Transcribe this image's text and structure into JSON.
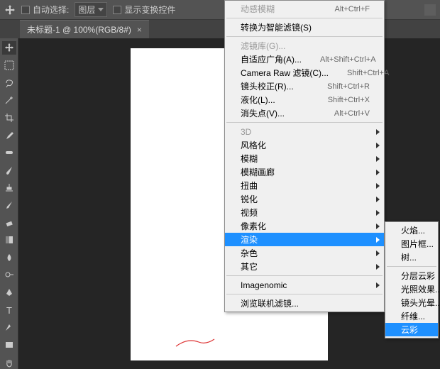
{
  "topbar": {
    "auto_select": "自动选择:",
    "layer_dropdown": "图层",
    "show_transform": "显示变换控件"
  },
  "tab": {
    "title": "未标题-1 @ 100%(RGB/8#)"
  },
  "filter_menu": {
    "last_filter": {
      "label": "动感模糊",
      "shortcut": "Alt+Ctrl+F"
    },
    "smart": "转换为智能滤镜(S)",
    "g1": [
      {
        "label": "滤镜库(G)...",
        "shortcut": ""
      },
      {
        "label": "自适应广角(A)...",
        "shortcut": "Alt+Shift+Ctrl+A"
      },
      {
        "label": "Camera Raw 滤镜(C)...",
        "shortcut": "Shift+Ctrl+A"
      },
      {
        "label": "镜头校正(R)...",
        "shortcut": "Shift+Ctrl+R"
      },
      {
        "label": "液化(L)...",
        "shortcut": "Shift+Ctrl+X"
      },
      {
        "label": "消失点(V)...",
        "shortcut": "Alt+Ctrl+V"
      }
    ],
    "g2": [
      "3D",
      "风格化",
      "模糊",
      "模糊画廊",
      "扭曲",
      "锐化",
      "视频",
      "像素化",
      "渲染",
      "杂色",
      "其它"
    ],
    "g3": "Imagenomic",
    "g4": "浏览联机滤镜..."
  },
  "submenu": {
    "items": [
      "火焰...",
      "图片框...",
      "树..."
    ],
    "items2": [
      "分层云彩",
      "光照效果...",
      "镜头光晕...",
      "纤维...",
      "云彩"
    ]
  }
}
